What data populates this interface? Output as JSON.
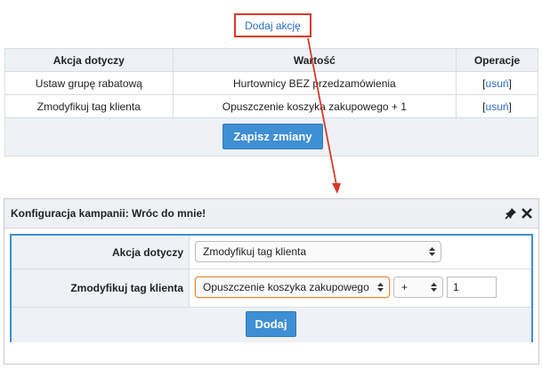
{
  "top": {
    "add_action_label": "Dodaj akcję"
  },
  "table": {
    "headers": [
      "Akcja dotyczy",
      "Wartość",
      "Operacje"
    ],
    "rows": [
      {
        "action": "Ustaw grupę rabatową",
        "value": "Hurtownicy BEZ przedzamówienia",
        "op_open": "[",
        "op_link": "usuń",
        "op_close": "]"
      },
      {
        "action": "Zmodyfikuj tag klienta",
        "value": "Opuszczenie koszyka zakupowego + 1",
        "op_open": "[",
        "op_link": "usuń",
        "op_close": "]"
      }
    ],
    "save_label": "Zapisz zmiany"
  },
  "panel": {
    "title": "Konfiguracja kampanii: Wróc do mnie!",
    "row1": {
      "label": "Akcja dotyczy",
      "select_value": "Zmodyfikuj tag klienta"
    },
    "row2": {
      "label": "Zmodyfikuj tag klienta",
      "tag_value": "Opuszczenie koszyka zakupowego",
      "operator": "+",
      "amount": "1"
    },
    "add_label": "Dodaj"
  },
  "colors": {
    "accent": "#3e8fd3",
    "link": "#2a6ebb",
    "highlight": "#d83a2a",
    "focus": "#e08a3a"
  }
}
